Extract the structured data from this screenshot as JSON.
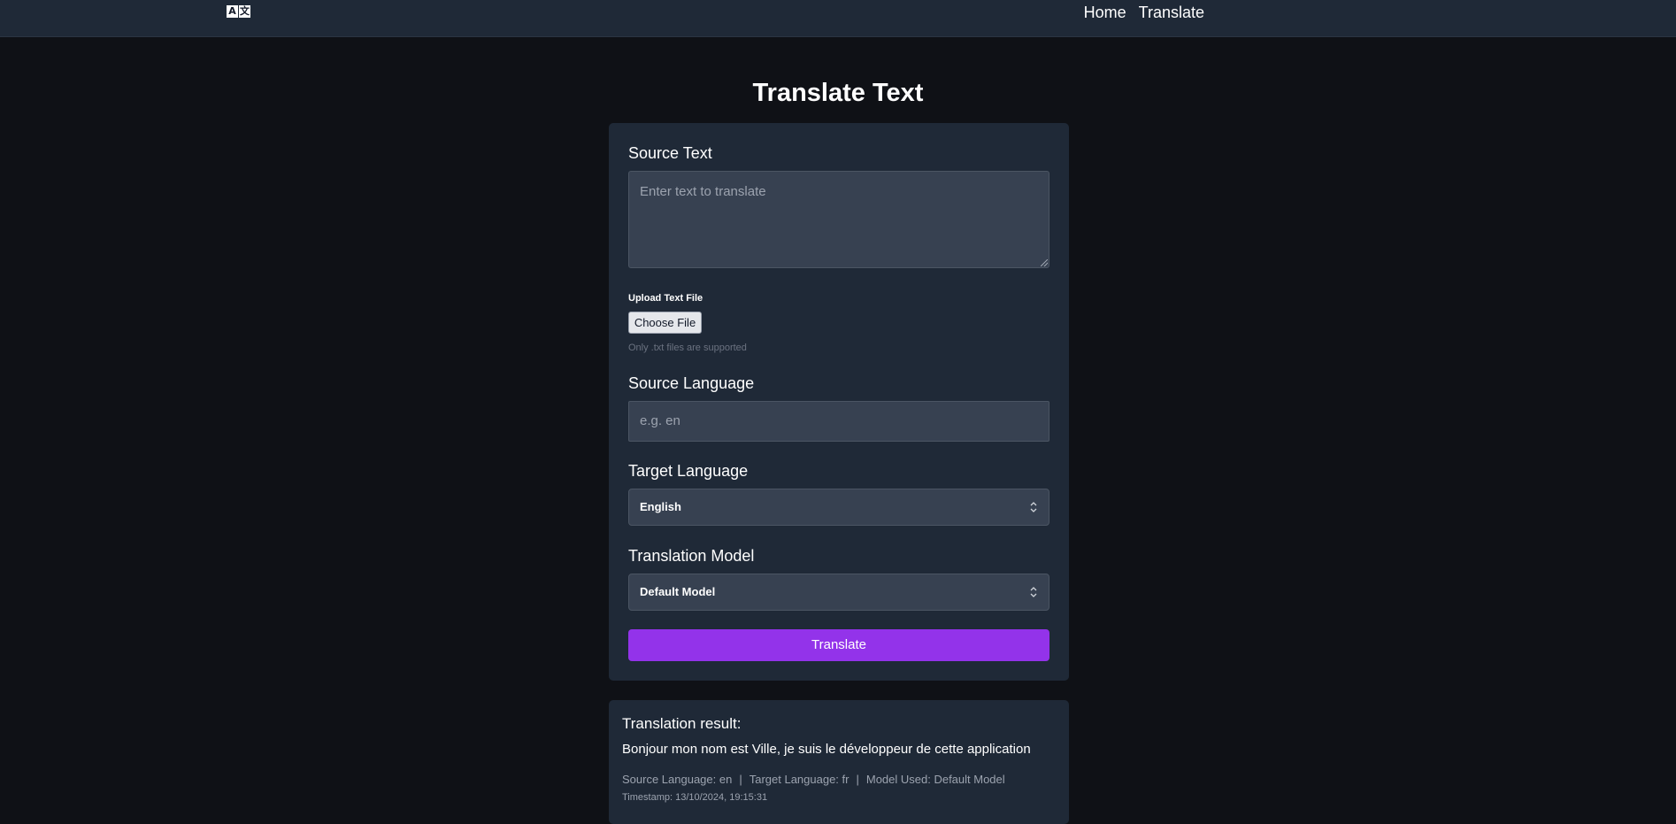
{
  "nav": {
    "logo_glyphs": [
      "A",
      "文"
    ],
    "links": [
      "Home",
      "Translate"
    ]
  },
  "page_title": "Translate Text",
  "form": {
    "source_text_label": "Source Text",
    "source_text_placeholder": "Enter text to translate",
    "upload_label": "Upload Text File",
    "choose_file_label": "Choose File",
    "upload_hint": "Only .txt files are supported",
    "source_language_label": "Source Language",
    "source_language_placeholder": "e.g. en",
    "target_language_label": "Target Language",
    "target_language_value": "English",
    "model_label": "Translation Model",
    "model_value": "Default Model",
    "translate_button": "Translate"
  },
  "result": {
    "heading": "Translation result:",
    "text": "Bonjour mon nom est Ville, je suis le développeur de cette application",
    "source_language": "Source Language: en",
    "target_language": "Target Language: fr",
    "model_used": "Model Used: Default Model",
    "timestamp": "Timestamp: 13/10/2024, 19:15:31"
  },
  "colors": {
    "background": "#0f1116",
    "card": "#1f2937",
    "input": "#374151",
    "accent": "#9333ea"
  }
}
